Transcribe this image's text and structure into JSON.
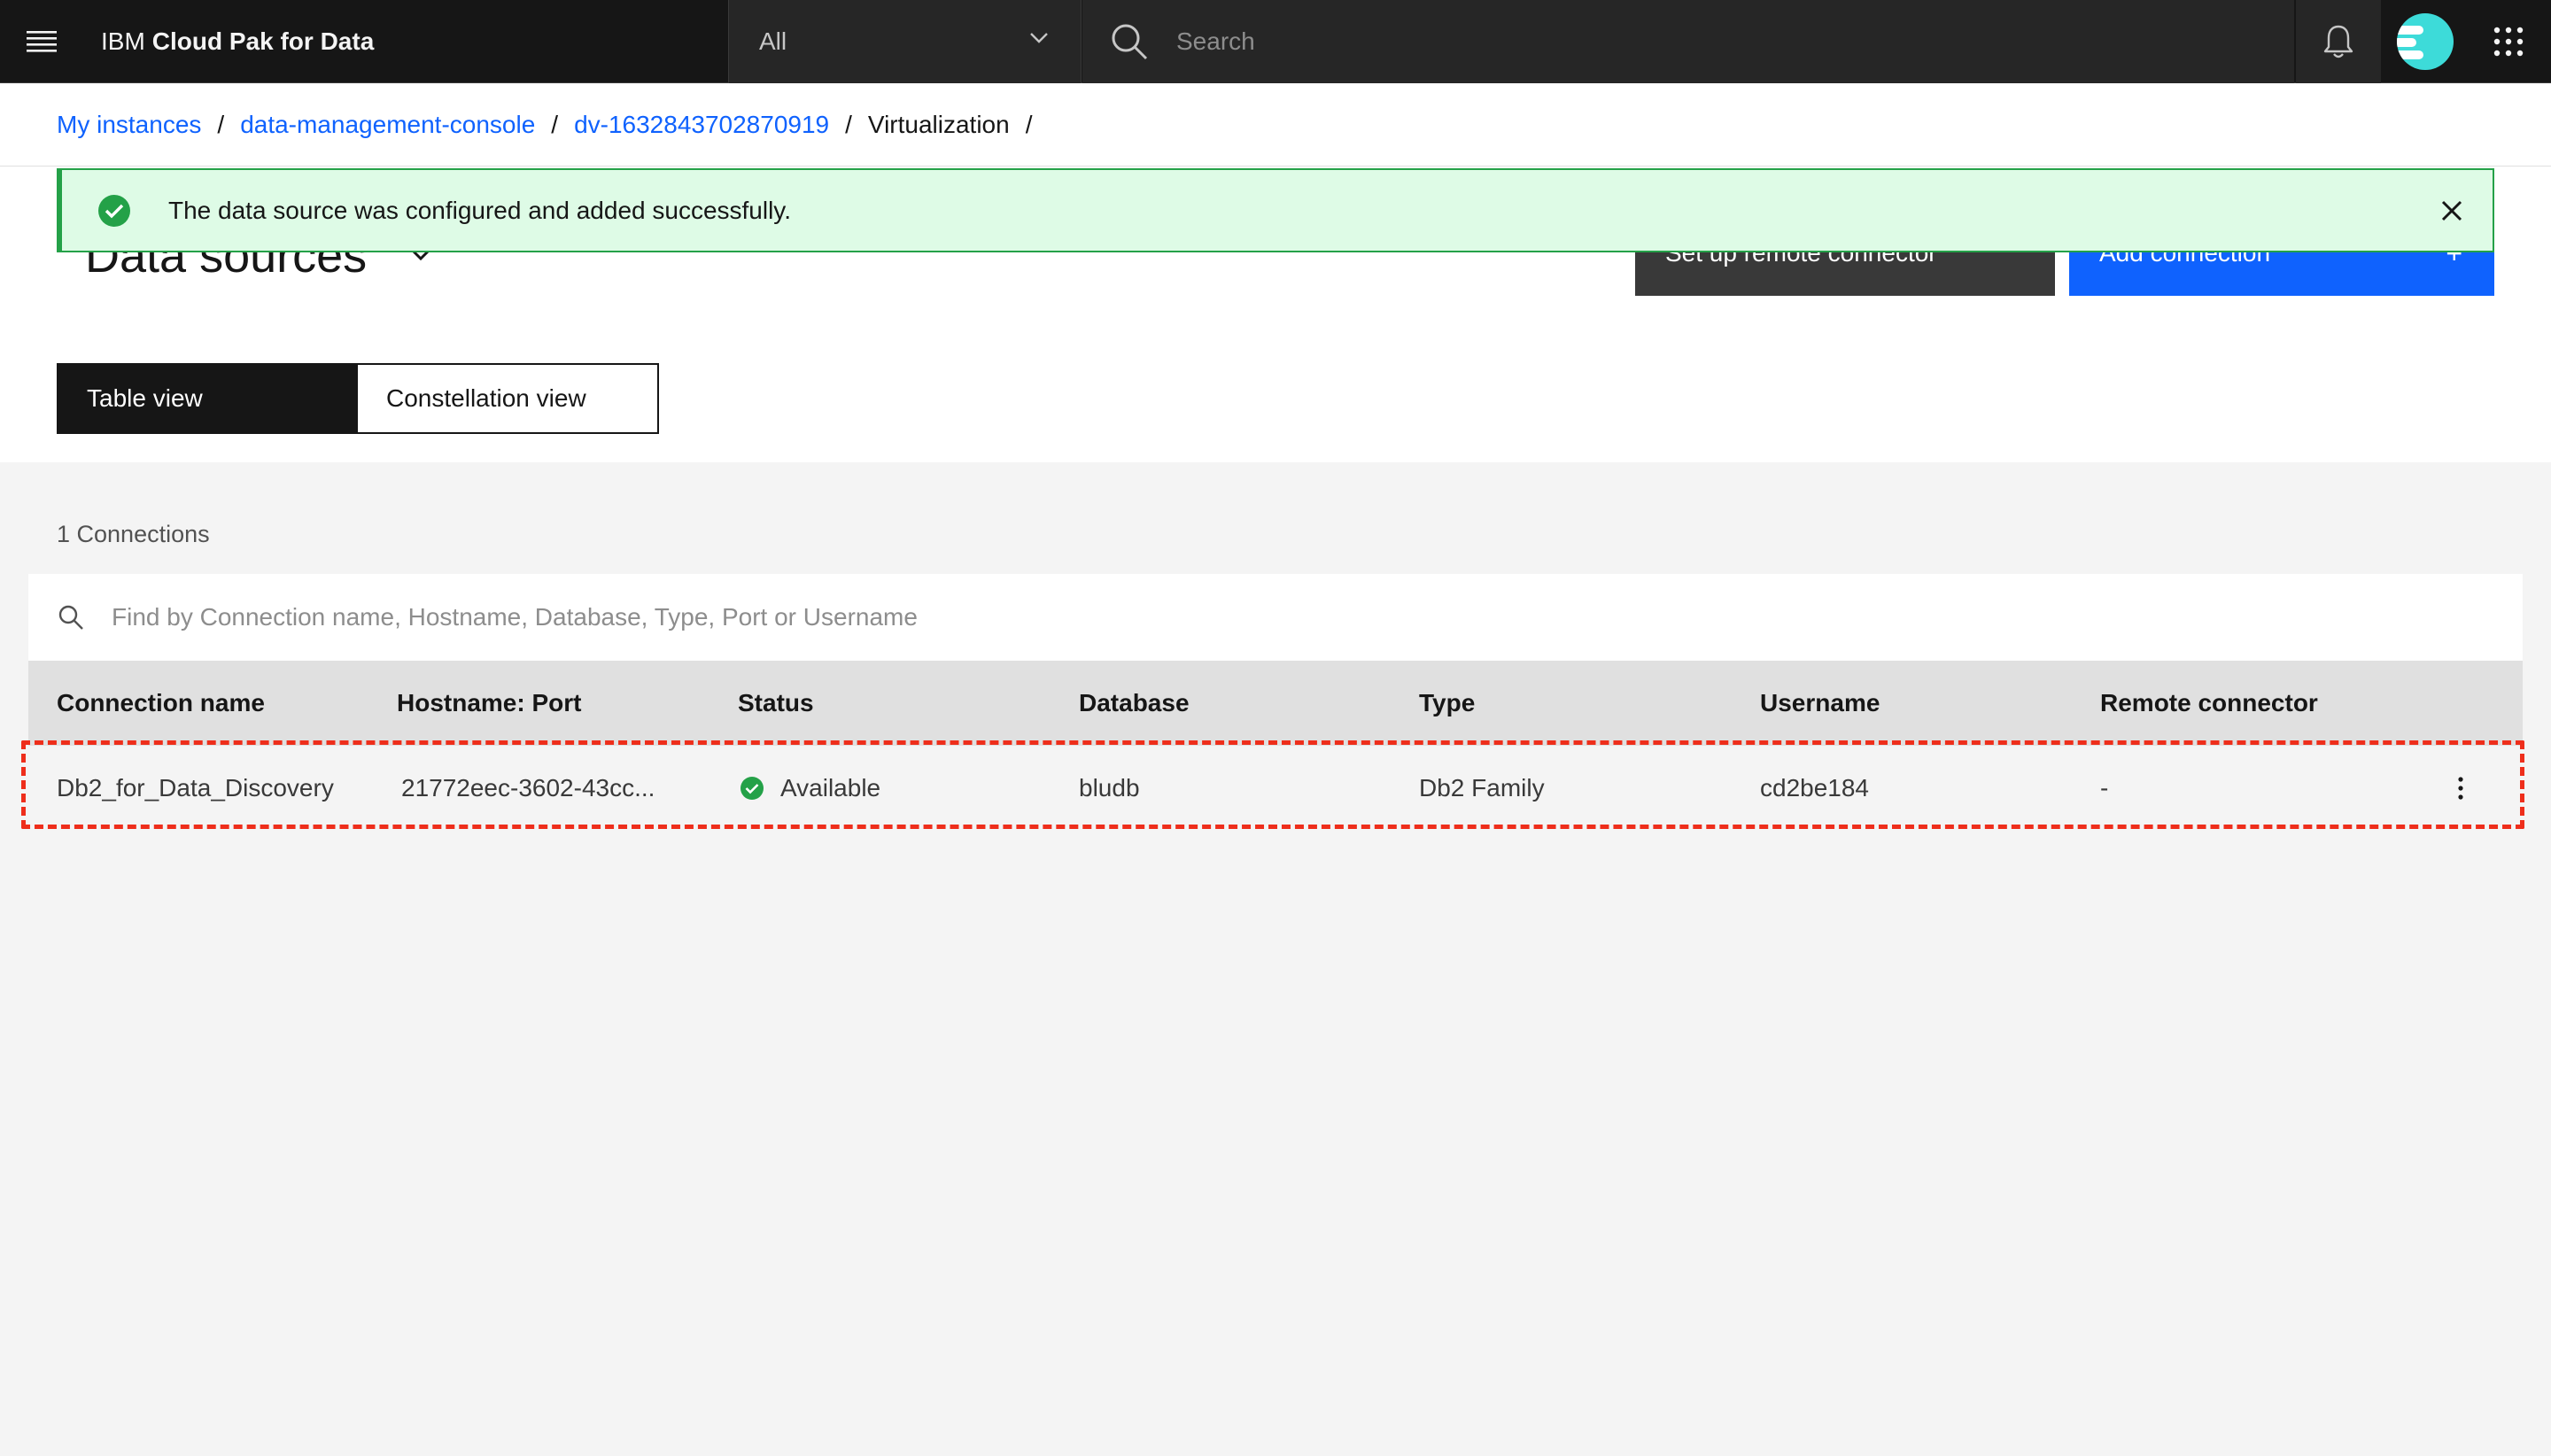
{
  "header": {
    "brand_prefix": "IBM",
    "brand_name": "Cloud Pak for Data",
    "scope_value": "All",
    "search_placeholder": "Search",
    "icons": [
      "menu-icon",
      "chevron-down-icon",
      "search-icon",
      "notification-icon",
      "avatar",
      "app-switcher-icon"
    ]
  },
  "breadcrumb": [
    {
      "label": "My instances",
      "link": true
    },
    {
      "label": "data-management-console",
      "link": true
    },
    {
      "label": "dv-1632843702870919",
      "link": true
    },
    {
      "label": "Virtualization",
      "link": false
    }
  ],
  "breadcrumb_separator": "/",
  "notification": {
    "kind": "success",
    "message": "The data source was configured and added successfully."
  },
  "page": {
    "title": "Data sources",
    "remote_connector_button": "Set up remote connector",
    "add_connection_button": "Add connection",
    "add_icon": "+"
  },
  "views": {
    "table": "Table view",
    "constellation": "Constellation view",
    "selected": "table"
  },
  "connections_count": "1 Connections",
  "table": {
    "search_placeholder": "Find by Connection name, Hostname, Database, Type, Port or Username",
    "columns": [
      "Connection name",
      "Hostname: Port",
      "Status",
      "Database",
      "Type",
      "Username",
      "Remote connector"
    ],
    "rows": [
      {
        "connection_name": "Db2_for_Data_Discovery",
        "hostname_port": "21772eec-3602-43cc...",
        "status": "Available",
        "database": "bludb",
        "type": "Db2 Family",
        "username": "cd2be184",
        "remote_connector": "-"
      }
    ]
  },
  "colors": {
    "header_bg": "#161616",
    "link": "#0f62fe",
    "success": "#24a148",
    "success_bg": "#defbe6",
    "primary_button": "#0f62fe",
    "highlight": "#ee2e1b"
  }
}
